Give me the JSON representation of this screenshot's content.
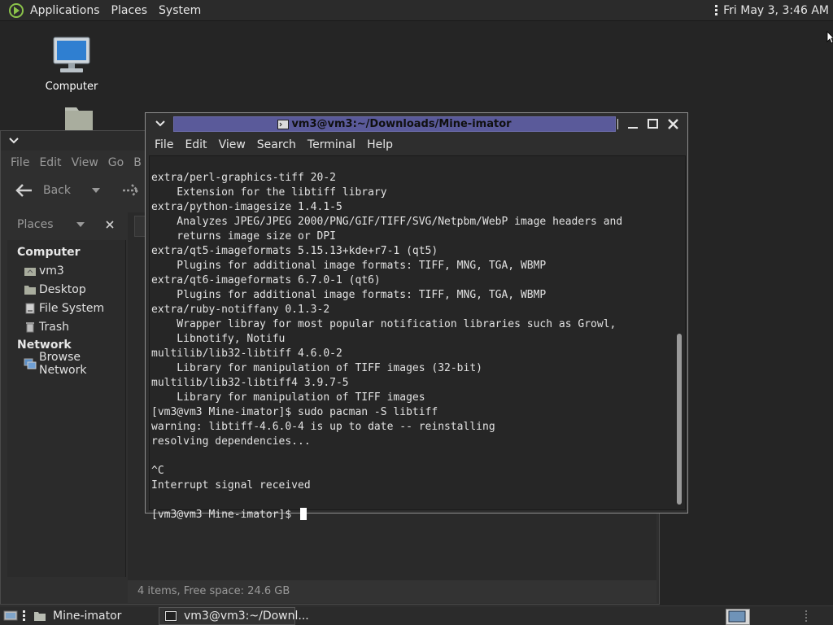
{
  "top_panel": {
    "menus": [
      "Applications",
      "Places",
      "System"
    ],
    "clock": "Fri May 3,  3:46 AM"
  },
  "desktop": {
    "icons": [
      {
        "label": "Computer"
      }
    ]
  },
  "file_manager": {
    "menus": [
      "File",
      "Edit",
      "View",
      "Go",
      "B"
    ],
    "back_label": "Back",
    "sidebar_header": "Places",
    "sections": {
      "computer": {
        "title": "Computer",
        "items": [
          "vm3",
          "Desktop",
          "File System",
          "Trash"
        ]
      },
      "network": {
        "title": "Network",
        "items": [
          "Browse Network"
        ]
      }
    },
    "status": "4 items, Free space: 24.6 GB"
  },
  "terminal": {
    "title": "vm3@vm3:~/Downloads/Mine-imator",
    "menus": [
      "File",
      "Edit",
      "View",
      "Search",
      "Terminal",
      "Help"
    ],
    "lines": [
      "extra/perl-graphics-tiff 20-2",
      "    Extension for the libtiff library",
      "extra/python-imagesize 1.4.1-5",
      "    Analyzes JPEG/JPEG 2000/PNG/GIF/TIFF/SVG/Netpbm/WebP image headers and",
      "    returns image size or DPI",
      "extra/qt5-imageformats 5.15.13+kde+r7-1 (qt5)",
      "    Plugins for additional image formats: TIFF, MNG, TGA, WBMP",
      "extra/qt6-imageformats 6.7.0-1 (qt6)",
      "    Plugins for additional image formats: TIFF, MNG, TGA, WBMP",
      "extra/ruby-notiffany 0.1.3-2",
      "    Wrapper libray for most popular notification libraries such as Growl,",
      "    Libnotify, Notifu",
      "multilib/lib32-libtiff 4.6.0-2",
      "    Library for manipulation of TIFF images (32-bit)",
      "multilib/lib32-libtiff4 3.9.7-5",
      "    Library for manipulation of TIFF images",
      "[vm3@vm3 Mine-imator]$ sudo pacman -S libtiff",
      "warning: libtiff-4.6.0-4 is up to date -- reinstalling",
      "resolving dependencies...",
      "",
      "^C",
      "Interrupt signal received",
      ""
    ],
    "prompt": "[vm3@vm3 Mine-imator]$ "
  },
  "taskbar": {
    "tasks": [
      "Mine-imator",
      "vm3@vm3:~/Downl..."
    ]
  },
  "colors": {
    "terminal_title_active": "#5a5a9a",
    "desktop_bg": "#252525"
  }
}
